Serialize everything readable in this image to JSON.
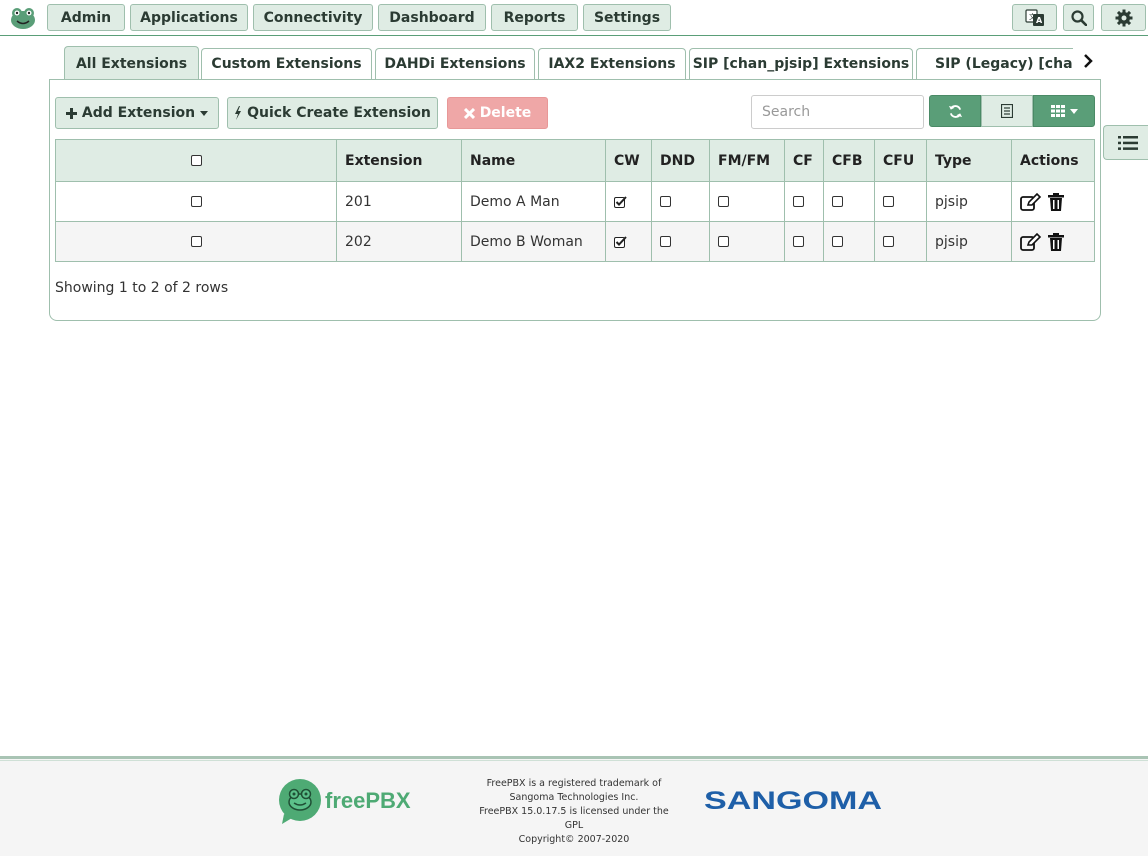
{
  "nav": {
    "items": [
      {
        "label": "Admin"
      },
      {
        "label": "Applications"
      },
      {
        "label": "Connectivity"
      },
      {
        "label": "Dashboard"
      },
      {
        "label": "Reports"
      },
      {
        "label": "Settings"
      }
    ]
  },
  "tabs": [
    {
      "label": "All Extensions",
      "active": true
    },
    {
      "label": "Custom Extensions"
    },
    {
      "label": "DAHDi Extensions"
    },
    {
      "label": "IAX2 Extensions"
    },
    {
      "label": "SIP [chan_pjsip] Extensions"
    },
    {
      "label": "SIP (Legacy) [chan_sip] Extensions"
    }
  ],
  "toolbar": {
    "add_label": "Add Extension",
    "quick_label": "Quick Create Extension",
    "delete_label": "Delete",
    "search_placeholder": "Search"
  },
  "table": {
    "columns": [
      "Extension",
      "Name",
      "CW",
      "DND",
      "FM/FM",
      "CF",
      "CFB",
      "CFU",
      "Type",
      "Actions"
    ],
    "rows": [
      {
        "extension": "201",
        "name": "Demo A Man",
        "cw": true,
        "dnd": false,
        "fmfm": false,
        "cf": false,
        "cfb": false,
        "cfu": false,
        "type": "pjsip"
      },
      {
        "extension": "202",
        "name": "Demo B Woman",
        "cw": true,
        "dnd": false,
        "fmfm": false,
        "cf": false,
        "cfb": false,
        "cfu": false,
        "type": "pjsip"
      }
    ]
  },
  "pagination": {
    "text": "Showing 1 to 2 of 2 rows"
  },
  "footer": {
    "freepbx_logo_text": "freePBX",
    "line1": "FreePBX is a registered trademark of",
    "line2": "Sangoma Technologies Inc.",
    "line3": "FreePBX 15.0.17.5 is licensed under the",
    "line4": "GPL",
    "line5": "Copyright© 2007-2020",
    "sangoma_logo_text": "SANGOMA"
  },
  "colors": {
    "accent": "#5a9e78",
    "button_bg": "#dfece4",
    "delete_disabled": "#efa7a7"
  }
}
